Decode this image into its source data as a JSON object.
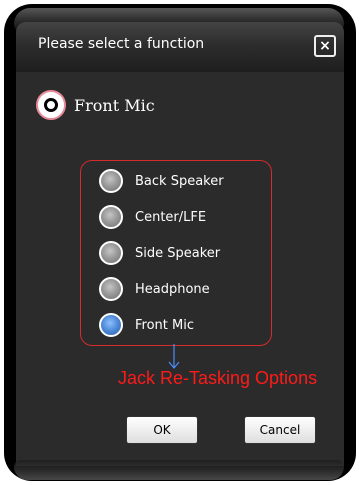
{
  "dialog": {
    "title": "Please select a function",
    "close_symbol": "×",
    "current_function": "Front Mic",
    "options": [
      {
        "label": "Back Speaker",
        "selected": false
      },
      {
        "label": "Center/LFE",
        "selected": false
      },
      {
        "label": "Side Speaker",
        "selected": false
      },
      {
        "label": "Headphone",
        "selected": false
      },
      {
        "label": "Front Mic",
        "selected": true
      }
    ],
    "annotation": "Jack Re-Tasking Options",
    "ok_label": "OK",
    "cancel_label": "Cancel"
  },
  "colors": {
    "annotation": "#ff1a1a",
    "selected_radio": "#4c88d6",
    "unselected_radio": "#9a9a9a",
    "annotation_box": "#d52b2b",
    "dialog_bg": "#2b2b2b"
  }
}
